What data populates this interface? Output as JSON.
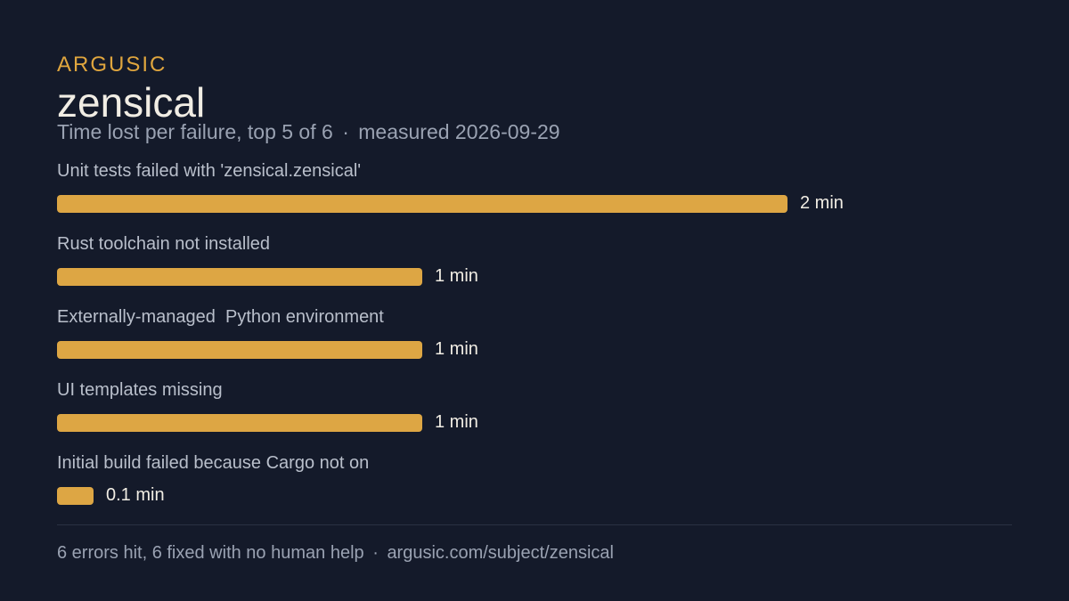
{
  "brand": "ARGUSIC",
  "title": "zensical",
  "subtitle": {
    "description": "Time lost per failure, top 5 of 6",
    "separator": "·",
    "measured": "measured 2026-09-29"
  },
  "chart_data": {
    "type": "bar",
    "orientation": "horizontal",
    "title": "zensical",
    "subtitle": "Time lost per failure, top 5 of 6 · measured 2026-09-29",
    "unit": "min",
    "categories": [
      "Unit tests failed with 'zensical.zensical'",
      "Rust toolchain not installed",
      "Externally-managed  Python environment",
      "UI templates missing",
      "Initial build failed because Cargo not on"
    ],
    "values": [
      2,
      1,
      1,
      1,
      0.1
    ],
    "value_labels": [
      "2 min",
      "1 min",
      "1 min",
      "1 min",
      "0.1 min"
    ],
    "xlim": [
      0,
      2
    ],
    "colors": {
      "bar": "#dda644",
      "background": "#141a2a"
    },
    "grid": false
  },
  "footer": {
    "stats": "6 errors hit, 6 fixed with no human help",
    "separator": "·",
    "link": "argusic.com/subject/zensical"
  }
}
